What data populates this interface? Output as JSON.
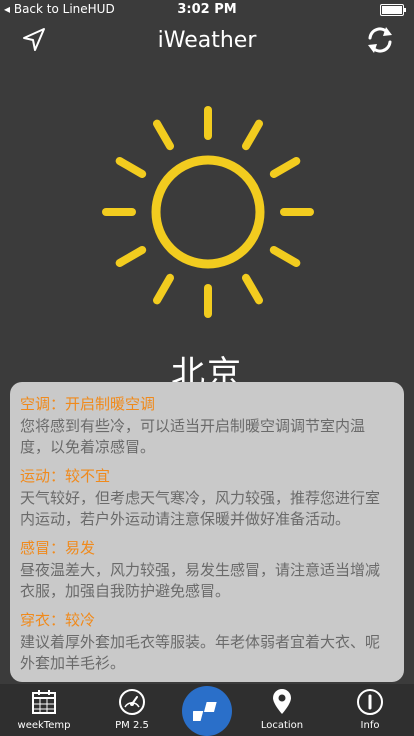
{
  "status": {
    "back_label": "◂ Back to LineHUD",
    "time": "3:02 PM"
  },
  "header": {
    "title": "iWeather"
  },
  "weather": {
    "city": "北京",
    "icon": "sun-icon",
    "icon_color": "#f2cc1f"
  },
  "indices": [
    {
      "title": "空调：开启制暖空调",
      "body": "您将感到有些冷，可以适当开启制暖空调调节室内温度，以免着凉感冒。"
    },
    {
      "title": "运动：较不宜",
      "body": "天气较好，但考虑天气寒冷，风力较强，推荐您进行室内运动，若户外运动请注意保暖并做好准备活动。"
    },
    {
      "title": "感冒：易发",
      "body": "昼夜温差大，风力较强，易发生感冒，请注意适当增减衣服，加强自我防护避免感冒。"
    },
    {
      "title": "穿衣：较冷",
      "body": "建议着厚外套加毛衣等服装。年老体弱者宜着大衣、呢外套加羊毛衫。"
    }
  ],
  "tabs": [
    {
      "label": "weekTemp",
      "icon": "calendar-icon"
    },
    {
      "label": "PM 2.5",
      "icon": "gauge-icon"
    },
    {
      "label": "",
      "icon": "app-logo-icon"
    },
    {
      "label": "Location",
      "icon": "map-pin-icon"
    },
    {
      "label": "Info",
      "icon": "info-icon"
    }
  ],
  "colors": {
    "background": "#3b3b3b",
    "panel": "#c9c9c9",
    "accent_orange": "#f08a1c",
    "tab_center": "#2a6fc9"
  }
}
